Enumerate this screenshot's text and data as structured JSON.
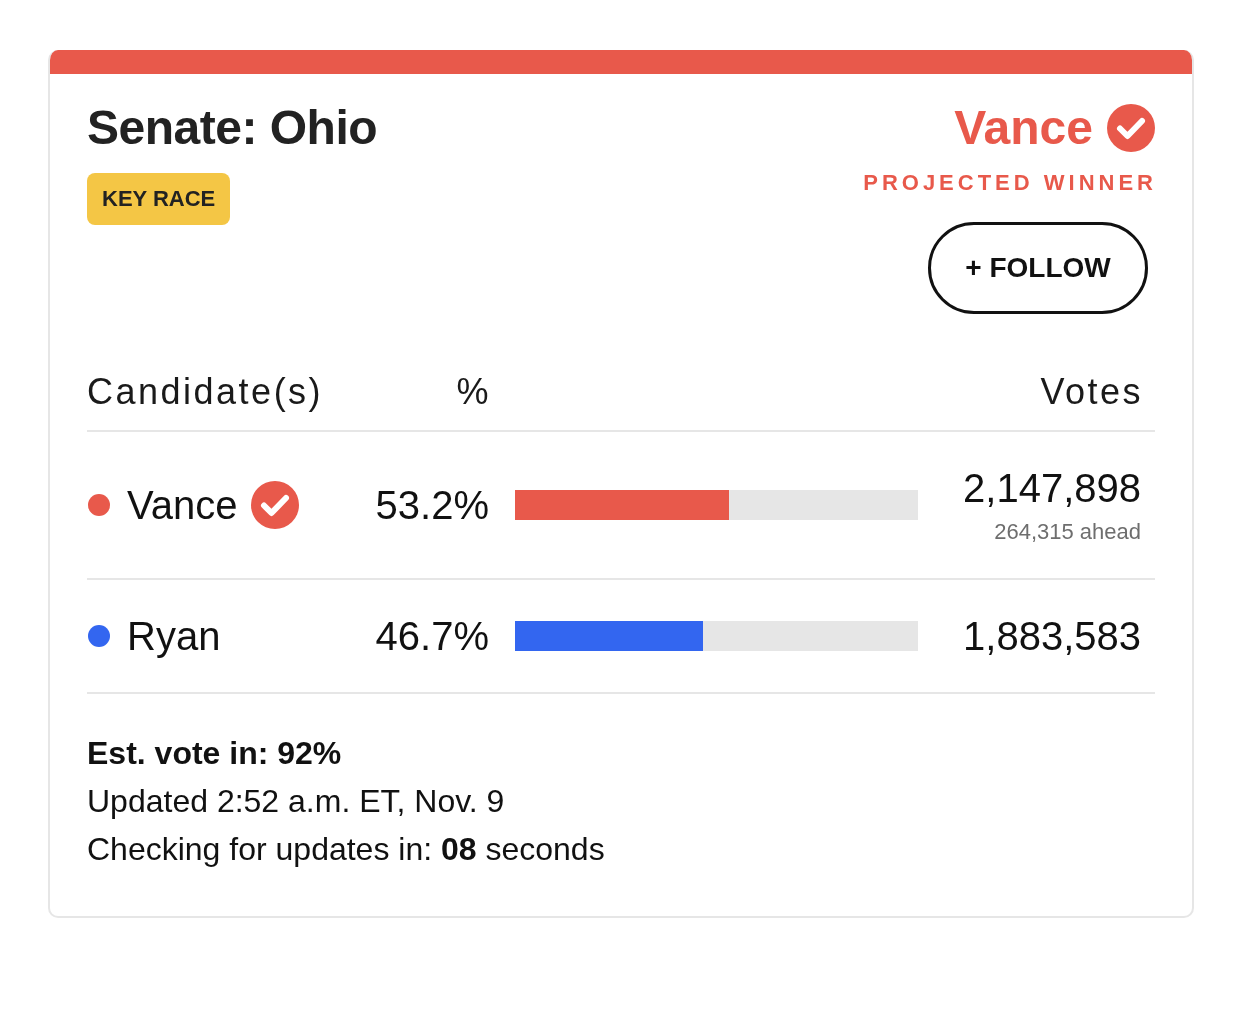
{
  "race": {
    "title": "Senate: Ohio",
    "badge": "KEY RACE"
  },
  "winner": {
    "name": "Vance",
    "checked": true,
    "label": "PROJECTED WINNER"
  },
  "follow_button": {
    "label": "+ FOLLOW"
  },
  "table": {
    "columns": [
      "Candidate(s)",
      "%",
      "Votes"
    ],
    "rows": [
      {
        "name": "Vance",
        "color": "#e8594b",
        "winner": true,
        "percent": "53.2%",
        "level": 0.532,
        "votes": "2,147,898",
        "lead": "264,315 ahead"
      },
      {
        "name": "Ryan",
        "color": "#3366f0",
        "winner": false,
        "percent": "46.7%",
        "level": 0.467,
        "votes": "1,883,583"
      }
    ]
  },
  "footer": {
    "estimate": "Est. vote in: 92%",
    "updated": "Updated 2:52 a.m. ET, Nov. 9",
    "countdown": "Checking for updates in: **08** seconds"
  }
}
